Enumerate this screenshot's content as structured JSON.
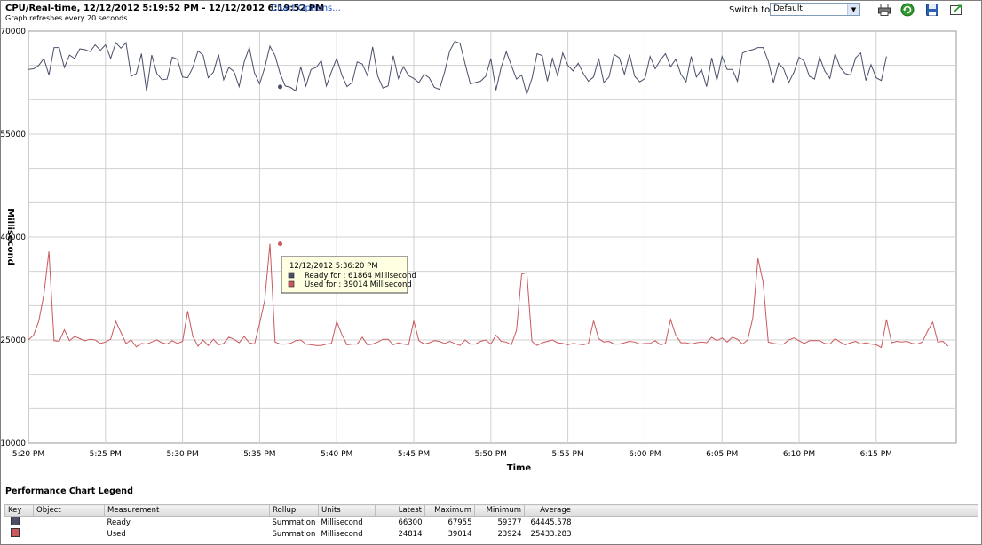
{
  "header": {
    "title": "CPU/Real-time, 12/12/2012 5:19:52 PM - 12/12/2012 6:19:52 PM",
    "chart_options_link": "Chart Options...",
    "subtitle": "Graph refreshes every 20 seconds",
    "switch_label": "Switch to:",
    "switch_value": "Default"
  },
  "toolbar": {
    "icons": [
      "print-icon",
      "refresh-icon",
      "save-icon",
      "export-icon"
    ]
  },
  "chart_data": {
    "type": "line",
    "xlabel": "Time",
    "ylabel": "Millisecond",
    "ylim": [
      10000,
      70000
    ],
    "y_ticks": [
      10000,
      25000,
      40000,
      55000,
      70000
    ],
    "x_ticks": [
      "5:20 PM",
      "5:25 PM",
      "5:30 PM",
      "5:35 PM",
      "5:40 PM",
      "5:45 PM",
      "5:50 PM",
      "5:55 PM",
      "6:00 PM",
      "6:05 PM",
      "6:10 PM",
      "6:15 PM"
    ],
    "x_start": "5:20 PM",
    "interval_seconds": 20,
    "grid": true,
    "series": [
      {
        "name": "Ready",
        "color": "#4a4f6a",
        "values": [
          64400,
          64500,
          65000,
          66000,
          63600,
          67600,
          67600,
          64700,
          66500,
          66000,
          67400,
          67300,
          67000,
          68000,
          67200,
          68000,
          66000,
          68300,
          67500,
          68300,
          63400,
          63800,
          66700,
          61200,
          66500,
          63800,
          62900,
          63000,
          66200,
          65900,
          63300,
          63200,
          64700,
          67100,
          66500,
          63200,
          64000,
          66600,
          62900,
          64700,
          64100,
          61900,
          65500,
          67600,
          63900,
          62300,
          64700,
          67800,
          66400,
          63800,
          62000,
          61800,
          61300,
          64800,
          62000,
          64400,
          64700,
          65700,
          62000,
          64100,
          66000,
          63600,
          61900,
          62500,
          65500,
          65200,
          63500,
          67700,
          63400,
          61700,
          62000,
          66400,
          63100,
          64800,
          63500,
          63100,
          62500,
          63700,
          63200,
          61800,
          61500,
          64000,
          67100,
          68500,
          68200,
          65200,
          62300,
          62500,
          62700,
          63400,
          66000,
          61400,
          64700,
          67000,
          65000,
          63000,
          63600,
          60800,
          63100,
          66700,
          66400,
          62700,
          66000,
          63500,
          66800,
          65000,
          64200,
          65300,
          63800,
          62700,
          63300,
          66000,
          62500,
          63300,
          66600,
          66100,
          63700,
          66600,
          63400,
          62600,
          63100,
          66300,
          64500,
          65800,
          66700,
          64800,
          65900,
          63700,
          62600,
          66300,
          63300,
          64400,
          61900,
          66100,
          62800,
          66300,
          64400,
          64400,
          62700,
          66800,
          67100,
          67300,
          67600,
          67600,
          65600,
          62500,
          65300,
          64500,
          62500,
          64000,
          66200,
          65600,
          63400,
          63000,
          66200,
          64200,
          63100,
          66700,
          64700,
          63800,
          63600,
          66100,
          66800,
          62800,
          65100,
          63200,
          62800,
          66300
        ]
      },
      {
        "name": "Used",
        "color": "#c9595e",
        "values": [
          25000,
          25700,
          27700,
          31600,
          37900,
          24900,
          24800,
          26500,
          24900,
          25500,
          25200,
          24900,
          25100,
          25000,
          24500,
          24700,
          25100,
          27700,
          26100,
          24500,
          25000,
          24000,
          24500,
          24400,
          24700,
          25000,
          24600,
          24400,
          24900,
          24500,
          24800,
          29200,
          25500,
          24100,
          25000,
          24200,
          25100,
          24300,
          24500,
          25400,
          25100,
          24600,
          25500,
          24600,
          24400,
          27400,
          30800,
          39014,
          24700,
          24400,
          24400,
          24500,
          24900,
          25000,
          24400,
          24300,
          24200,
          24200,
          24400,
          24500,
          27700,
          25800,
          24300,
          24400,
          24400,
          25400,
          24300,
          24400,
          24700,
          25100,
          25100,
          24300,
          24600,
          24400,
          24300,
          27800,
          24900,
          24400,
          24600,
          24900,
          24800,
          24500,
          24800,
          24500,
          24200,
          25000,
          24400,
          24400,
          24800,
          25000,
          24400,
          25700,
          24800,
          24700,
          24300,
          26400,
          34600,
          34800,
          24800,
          24200,
          24600,
          24800,
          25000,
          24600,
          24500,
          24300,
          24500,
          24400,
          24300,
          24500,
          27800,
          25200,
          24700,
          24800,
          24400,
          24400,
          24600,
          24800,
          24700,
          24400,
          24500,
          24500,
          24900,
          24300,
          24500,
          28000,
          25700,
          24600,
          24600,
          24400,
          24600,
          24700,
          24600,
          25400,
          24900,
          25300,
          24700,
          25400,
          25100,
          24400,
          25000,
          28200,
          36900,
          33400,
          24700,
          24500,
          24400,
          24400,
          25000,
          25300,
          24900,
          24500,
          24900,
          24900,
          24900,
          24500,
          24400,
          25200,
          24700,
          24300,
          24600,
          24800,
          24400,
          24600,
          24400,
          24300,
          23900,
          28000,
          24600,
          24800,
          24700,
          24800,
          24500,
          24400,
          24700,
          26300,
          27600,
          24700,
          24800,
          24100
        ]
      }
    ],
    "tooltip": {
      "time": "12/12/2012 5:36:20 PM",
      "index": 49,
      "lines": [
        "Ready for : 61864 Millisecond",
        "Used for : 39014 Millisecond"
      ],
      "ready_value": 61864,
      "used_value": 39014
    }
  },
  "legend": {
    "title": "Performance Chart Legend",
    "columns": [
      "Key",
      "Object",
      "Measurement",
      "Rollup",
      "Units",
      "Latest",
      "Maximum",
      "Minimum",
      "Average"
    ],
    "rows": [
      {
        "key_color": "#4a4f6a",
        "object": "",
        "measurement": "Ready",
        "rollup": "Summation",
        "units": "Millisecond",
        "latest": "66300",
        "maximum": "67955",
        "minimum": "59377",
        "average": "64445.578"
      },
      {
        "key_color": "#c9595e",
        "object": "",
        "measurement": "Used",
        "rollup": "Summation",
        "units": "Millisecond",
        "latest": "24814",
        "maximum": "39014",
        "minimum": "23924",
        "average": "25433.283"
      }
    ]
  }
}
